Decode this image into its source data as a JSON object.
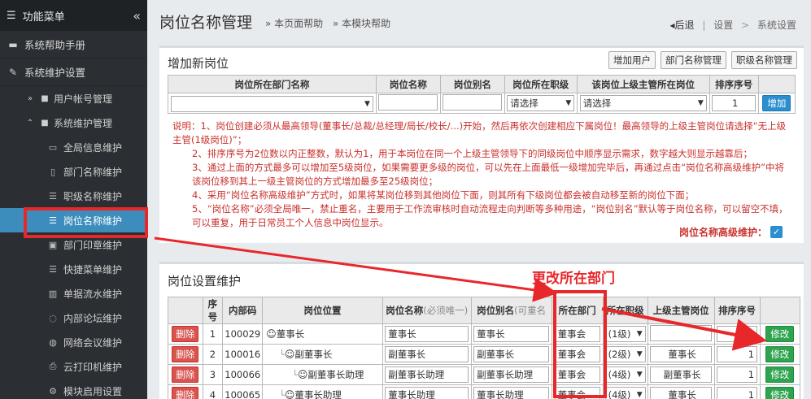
{
  "sidebar": {
    "header": "功能菜单",
    "collapse_icon": "double-chevron-left-icon",
    "items": [
      {
        "label": "系统帮助手册",
        "icon": "book-icon"
      },
      {
        "label": "系统维护设置",
        "icon": "wrench-icon"
      }
    ],
    "subgroups": [
      {
        "label": "用户帐号管理",
        "icon": "folder-icon"
      },
      {
        "label": "系统维护管理",
        "icon": "folder-open-icon"
      }
    ],
    "leaves": [
      {
        "label": "全局信息维护",
        "icon": "monitor-icon"
      },
      {
        "label": "部门名称维护",
        "icon": "document-icon"
      },
      {
        "label": "职级名称维护",
        "icon": "list-icon"
      },
      {
        "label": "岗位名称维护",
        "icon": "list-icon",
        "active": true
      },
      {
        "label": "部门印章维护",
        "icon": "stamp-icon"
      },
      {
        "label": "快捷菜单维护",
        "icon": "list-icon"
      },
      {
        "label": "单据流水维护",
        "icon": "barcode-icon"
      },
      {
        "label": "内部论坛维护",
        "icon": "chat-icon"
      },
      {
        "label": "网络会议维护",
        "icon": "comment-icon"
      },
      {
        "label": "云打印机维护",
        "icon": "printer-icon"
      },
      {
        "label": "模块启用设置",
        "icon": "settings-icon"
      }
    ]
  },
  "header": {
    "title": "岗位名称管理",
    "help_links": [
      "» 本页面帮助",
      "» 本模块帮助"
    ],
    "breadcrumb": {
      "back": "◂后退",
      "items": [
        "设置",
        "系统设置"
      ]
    }
  },
  "add_panel": {
    "title": "增加新岗位",
    "buttons": [
      "增加用户",
      "部门名称管理",
      "职级名称管理"
    ],
    "columns": [
      "岗位所在部门名称",
      "岗位名称",
      "岗位别名",
      "岗位所在职级",
      "该岗位上级主管所在岗位",
      "排序序号"
    ],
    "dept_value": "",
    "level_select": "请选择",
    "superior_select": "请选择",
    "order_value": "1",
    "add_button": "增加",
    "notes": [
      "说明：1、岗位创建必须从最高领导(董事长/总裁/总经理/局长/校长/...)开始，然后再依次创建相应下属岗位！最高领导的上级主管岗位请选择“无上级主管(1级岗位)”；",
      "2、排序序号为2位数以内正整数，默认为1，用于本岗位在同一个上级主管领导下的同级岗位中顺序显示需求，数字越大则显示越靠后；",
      "3、通过上面的方式最多可以增加至5级岗位，如果需要更多级的岗位，可以先在上面最低一级增加完毕后，再通过点击“岗位名称高级维护”中将该岗位移到其上一级主管岗位的方式增加最多至25级岗位；",
      "4、采用“岗位名称高级维护”方式时，如果将某岗位移到其他岗位下面，则其所有下级岗位都会被自动移至新的岗位下面；",
      "5、“岗位名称”必须全局唯一，禁止重名，主要用于工作流审核时自动流程走向判断等多种用途，“岗位别名”默认等于岗位名称，可以留空不填，可以重复，用于日常员工个人信息中岗位显示。"
    ],
    "advanced_label": "岗位名称高级维护：",
    "advanced_checked": true
  },
  "maint_panel": {
    "title": "岗位设置维护",
    "annotation": "更改所在部门",
    "columns": {
      "serial": "序号",
      "code": "内部码",
      "position": "岗位位置",
      "name": "岗位名称",
      "name_note": "(必须唯一)",
      "alias": "岗位别名",
      "alias_note": "(可重名",
      "dept": "所在部门",
      "level": "所在职级",
      "superior": "上级主管岗位",
      "order": "排序序号"
    },
    "delete_label": "删除",
    "edit_label": "修改",
    "rows": [
      {
        "serial": "1",
        "code": "100029",
        "position": "董事长",
        "depth": 0,
        "name": "董事长",
        "alias": "董事长",
        "dept": "董事会",
        "level": "(1级)",
        "superior": "",
        "order": "1"
      },
      {
        "serial": "2",
        "code": "100016",
        "position": "副董事长",
        "depth": 1,
        "name": "副董事长",
        "alias": "副董事长",
        "dept": "董事会",
        "level": "(2级)",
        "superior": "董事长",
        "order": "1"
      },
      {
        "serial": "3",
        "code": "100066",
        "position": "副董事长助理",
        "depth": 2,
        "name": "副董事长助理",
        "alias": "副董事长助理",
        "dept": "董事会",
        "level": "(4级)",
        "superior": "副董事长",
        "order": "1"
      },
      {
        "serial": "4",
        "code": "100065",
        "position": "董事长助理",
        "depth": 1,
        "name": "董事长助理",
        "alias": "董事长助理",
        "dept": "董事会",
        "level": "(4级)",
        "superior": "董事长",
        "order": "1"
      }
    ]
  },
  "colors": {
    "sidebar_bg": "#2b2f33",
    "active_bg": "#3c8dbc",
    "annotation_red": "#e8272b",
    "delete_red": "#d9534f",
    "edit_green": "#2ea44f",
    "add_blue": "#2b8ecf"
  }
}
